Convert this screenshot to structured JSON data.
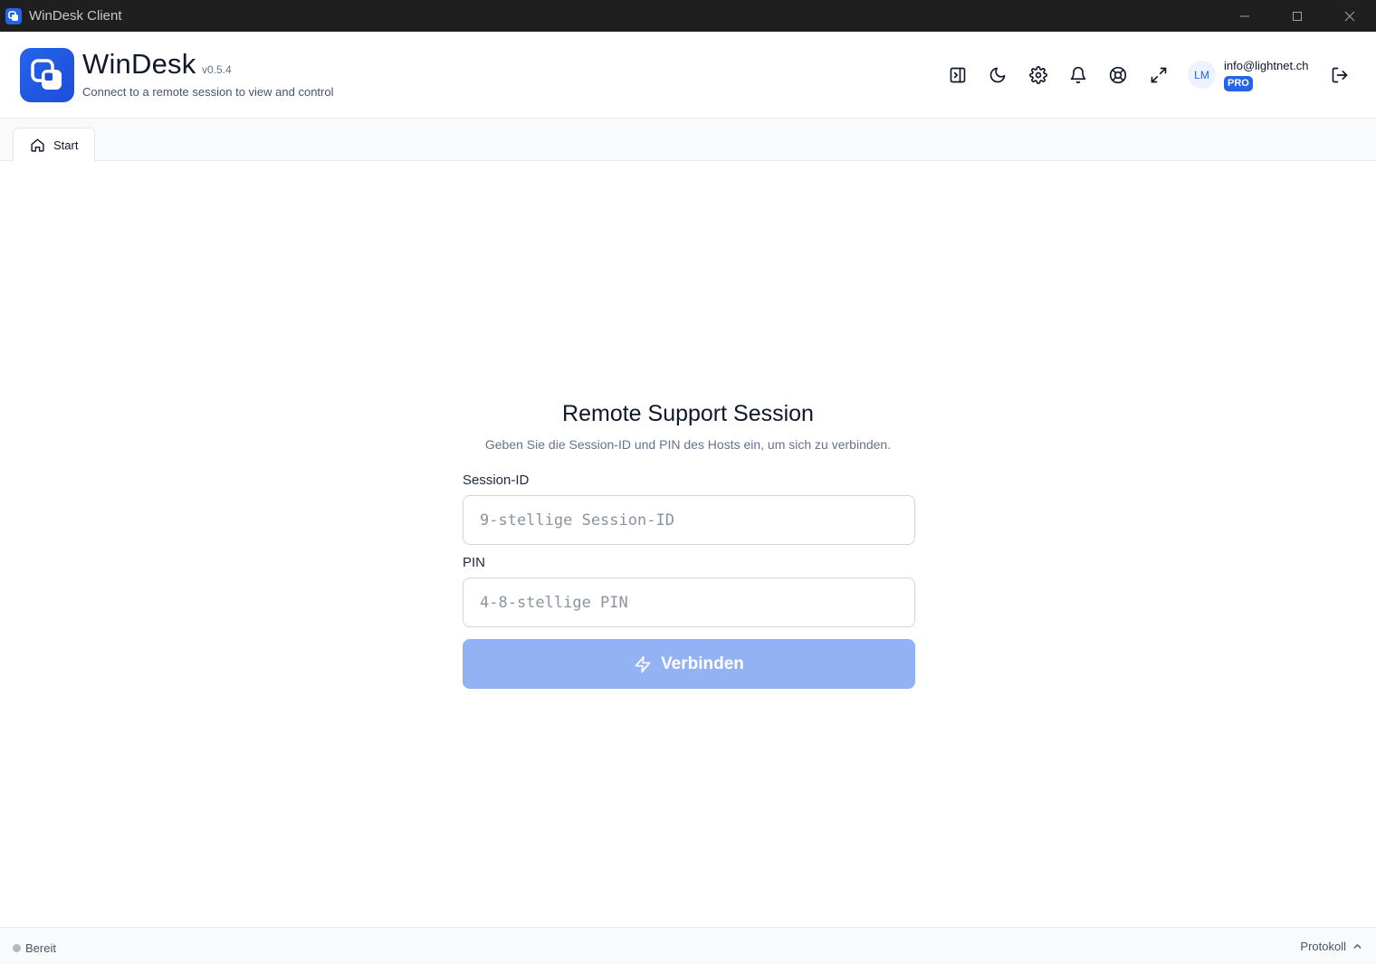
{
  "window": {
    "title": "WinDesk Client",
    "controls": [
      "minimize-icon",
      "maximize-icon",
      "close-icon"
    ]
  },
  "header": {
    "app_name": "WinDesk",
    "version": "v0.5.4",
    "subtitle": "Connect to a remote session to view and control",
    "icons": [
      "sidebar-toggle-icon",
      "moon-icon",
      "gear-icon",
      "bell-icon",
      "lifebuoy-icon",
      "expand-icon"
    ],
    "user": {
      "initials": "LM",
      "email": "info@lightnet.ch",
      "plan": "PRO"
    },
    "logout_icon": "logout-icon"
  },
  "tabs": [
    {
      "label": "Start",
      "icon": "home-icon",
      "active": true
    }
  ],
  "main": {
    "title": "Remote Support Session",
    "description": "Geben Sie die Session-ID und PIN des Hosts ein, um sich zu verbinden.",
    "session_id": {
      "label": "Session-ID",
      "placeholder": "9-stellige Session-ID",
      "value": ""
    },
    "pin": {
      "label": "PIN",
      "placeholder": "4-8-stellige PIN",
      "value": ""
    },
    "connect_button": {
      "label": "Verbinden",
      "icon": "lightning-icon",
      "disabled": true
    }
  },
  "statusbar": {
    "status": "Bereit",
    "log_label": "Protokoll"
  },
  "colors": {
    "accent": "#2563eb",
    "button_disabled": "#93b2f3",
    "titlebar": "#1f1f1f"
  }
}
